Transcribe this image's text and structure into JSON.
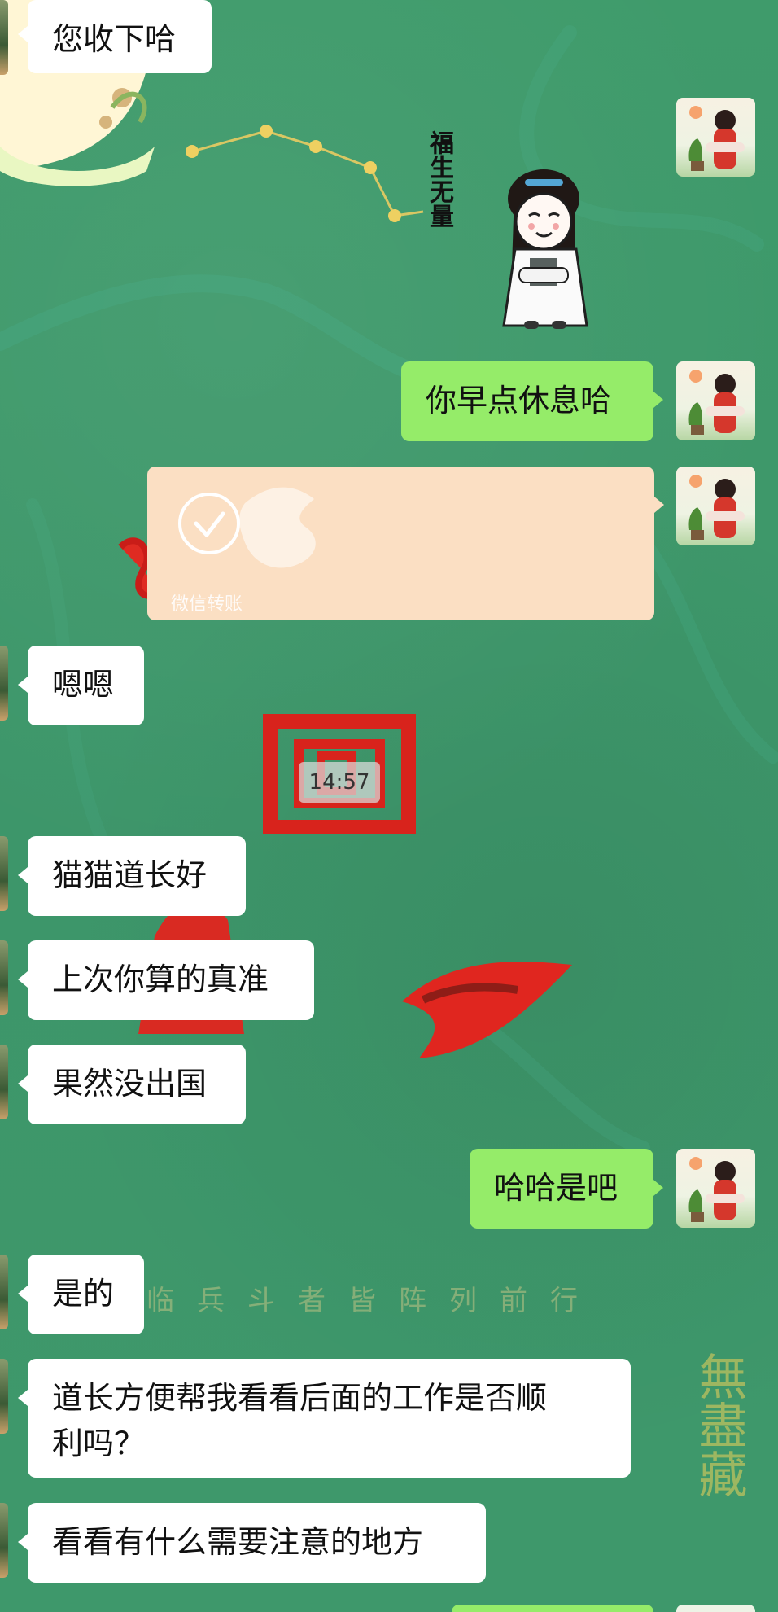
{
  "messages": {
    "top_incoming": "您收下哈",
    "sticker_text": "福生无量",
    "outgoing_1": "你早点休息哈",
    "transfer_label": "微信转账",
    "incoming_1": "嗯嗯",
    "timestamp": "14:57",
    "incoming_2": "猫猫道长好",
    "incoming_3": "上次你算的真准",
    "incoming_4": "果然没出国",
    "outgoing_2": "哈哈是吧",
    "incoming_5": "是的",
    "incoming_6": "道长方便帮我看看后面的工作是否顺\n利吗？",
    "incoming_7": "看看有什么需要注意的地方"
  },
  "background": {
    "watermark_line": "临兵斗者皆阵列前行",
    "watermark_seal": "無盡藏"
  },
  "colors": {
    "chat_background": "#3f9a6a",
    "incoming_bubble": "#ffffff",
    "outgoing_bubble": "#95ec69",
    "transfer_card": "#fbdfc3"
  }
}
